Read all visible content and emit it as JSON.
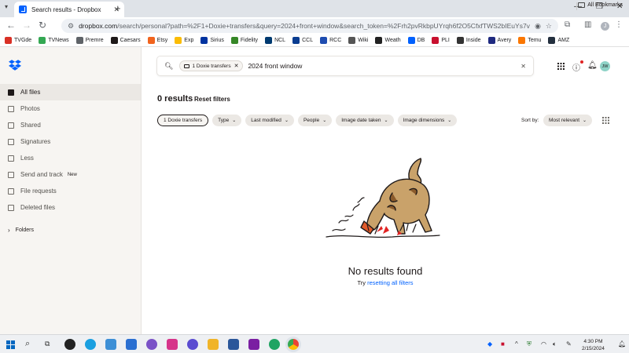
{
  "browser": {
    "tab_title": "Search results - Dropbox",
    "tab_close": "✕",
    "new_tab": "+",
    "url_host": "dropbox.com",
    "url_rest": "/search/personal?path=%2F1+Doxie+transfers&query=2024+front+window&search_token=%2Frh2pvRkbpUYrqh6f2O5CfxfTWS2bIEuYs7vi0VyBW0%3D&typeahe...",
    "profile_initial": "J",
    "bookmarks": [
      {
        "label": "TVGde",
        "color": "#d93025"
      },
      {
        "label": "TVNews",
        "color": "#34a853"
      },
      {
        "label": "Premre",
        "color": "#5f6368"
      },
      {
        "label": "Caesars",
        "color": "#1e1919"
      },
      {
        "label": "Etsy",
        "color": "#f1641e"
      },
      {
        "label": "Exp",
        "color": "#fbbc04"
      },
      {
        "label": "Sirius",
        "color": "#0033a0"
      },
      {
        "label": "Fidelity",
        "color": "#368727"
      },
      {
        "label": "NCL",
        "color": "#003a70"
      },
      {
        "label": "CCL",
        "color": "#0a3d91"
      },
      {
        "label": "RCC",
        "color": "#1e4cb0"
      },
      {
        "label": "Wiki",
        "color": "#555555"
      },
      {
        "label": "Weath",
        "color": "#222222"
      },
      {
        "label": "DB",
        "color": "#0061fe"
      },
      {
        "label": "PLI",
        "color": "#c8102e"
      },
      {
        "label": "Inside",
        "color": "#333333"
      },
      {
        "label": "Avery",
        "color": "#1f2a80"
      },
      {
        "label": "Temu",
        "color": "#fb7701"
      },
      {
        "label": "AMZ",
        "color": "#232f3e"
      }
    ],
    "all_bookmarks": "All Bookmarks"
  },
  "sidebar": {
    "items": [
      {
        "label": "All files",
        "active": true
      },
      {
        "label": "Photos"
      },
      {
        "label": "Shared"
      },
      {
        "label": "Signatures"
      },
      {
        "label": "Less"
      },
      {
        "label": "Send and track",
        "badge": "New"
      },
      {
        "label": "File requests"
      },
      {
        "label": "Deleted files"
      }
    ],
    "folders_label": "Folders"
  },
  "search": {
    "chip_label": "1 Doxie transfers",
    "query": "2024 front window"
  },
  "header": {
    "user_initials": "JW"
  },
  "results": {
    "count_label": "0 results",
    "reset_label": "Reset filters",
    "filters": [
      {
        "label": "1 Doxie transfers",
        "active": true
      },
      {
        "label": "Type"
      },
      {
        "label": "Last modified"
      },
      {
        "label": "People"
      },
      {
        "label": "Image date taken"
      },
      {
        "label": "Image dimensions"
      }
    ],
    "sort_label": "Sort by:",
    "sort_value": "Most relevant",
    "empty_title": "No results found",
    "empty_prefix": "Try",
    "empty_link": "resetting all filters"
  },
  "taskbar": {
    "time": "4:30 PM",
    "date": "2/15/2024"
  }
}
